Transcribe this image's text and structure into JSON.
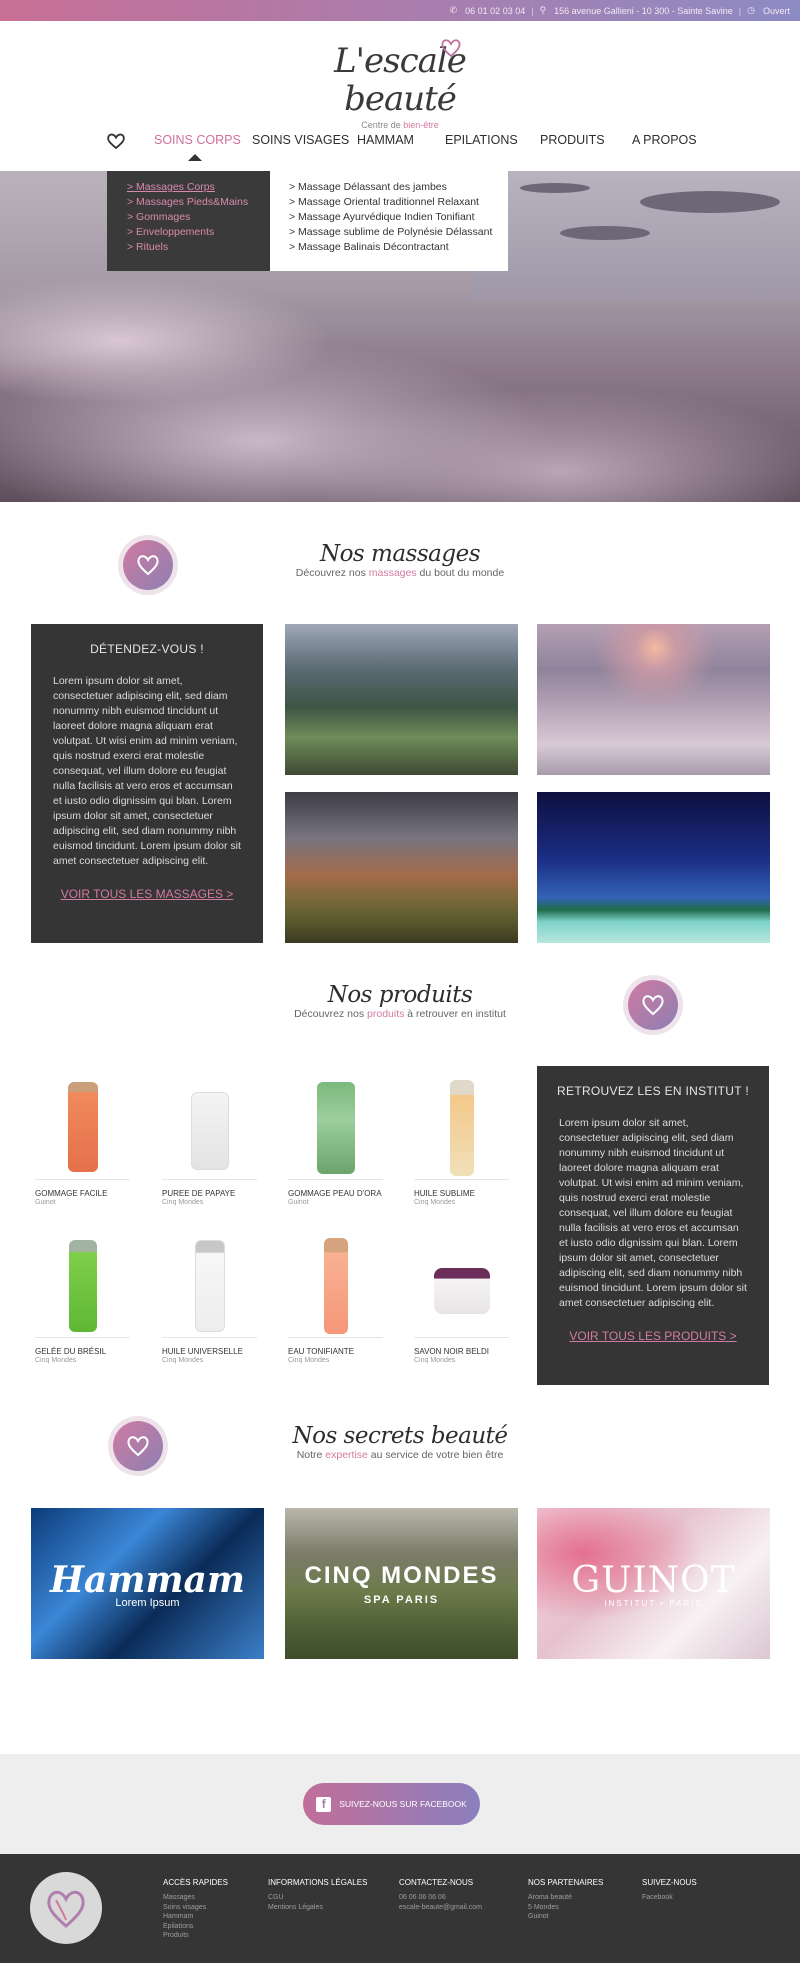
{
  "topbar": {
    "phone": "06 01 02 03 04",
    "address": "156 avenue Gallieni - 10 300 - Sainte Savine",
    "status": "Ouvert",
    "colors": {
      "gradient_start": "#c86f95",
      "gradient_end": "#8d8bc4"
    }
  },
  "logo": {
    "brand": "L'escale beauté",
    "tagline_prefix": "Centre de ",
    "tagline_highlight": "bien-être"
  },
  "nav": {
    "items": [
      {
        "label": "SOINS CORPS",
        "active": true
      },
      {
        "label": "SOINS VISAGES"
      },
      {
        "label": "HAMMAM"
      },
      {
        "label": "EPILATIONS"
      },
      {
        "label": "PRODUITS"
      },
      {
        "label": "A PROPOS"
      }
    ]
  },
  "dropdown": {
    "left": [
      "> Massages Corps",
      "> Massages Pieds&Mains",
      "> Gommages",
      "> Enveloppements",
      "> Rituels"
    ],
    "right": [
      "> Massage Délassant des jambes",
      "> Massage Oriental traditionnel Relaxant",
      "> Massage Ayurvédique Indien Tonifiant",
      "> Massage sublime de Polynésie Délassant",
      "> Massage Balinais Décontractant"
    ]
  },
  "massages": {
    "title": "Nos massages",
    "sub_prefix": "Découvrez nos ",
    "sub_highlight": "massages",
    "sub_suffix": " du bout du monde",
    "box": {
      "heading": "DÉTENDEZ-VOUS !",
      "text": "Lorem ipsum dolor sit amet, consectetuer adipiscing elit, sed diam nonummy nibh euismod tincidunt ut laoreet dolore magna aliquam erat volutpat. Ut wisi enim ad minim veniam, quis nostrud exerci erat molestie consequat, vel illum dolore eu feugiat nulla facilisis at vero eros et accumsan et iusto odio dignissim qui blan. Lorem ipsum dolor sit amet, consectetuer adipiscing elit, sed diam nonummy nibh euismod tincidunt. Lorem ipsum dolor sit amet consectetuer adipiscing elit.",
      "link": "VOIR TOUS LES MASSAGES >"
    }
  },
  "produits": {
    "title": "Nos produits",
    "sub_prefix": "Découvrez nos ",
    "sub_highlight": "produits",
    "sub_suffix": " à retrouver en institut",
    "items": [
      {
        "name": "GOMMAGE FACILE",
        "brand": "Guinot"
      },
      {
        "name": "PUREE DE PAPAYE",
        "brand": "Cinq Mondes"
      },
      {
        "name": "GOMMAGE PEAU D'ORA",
        "brand": "Guinot"
      },
      {
        "name": "HUILE SUBLIME",
        "brand": "Cinq Mondes"
      },
      {
        "name": "GELÉE DU BRÉSIL",
        "brand": "Cinq Mondes"
      },
      {
        "name": "HUILE UNIVERSELLE",
        "brand": "Cinq Mondes"
      },
      {
        "name": "EAU TONIFIANTE",
        "brand": "Cinq Mondes"
      },
      {
        "name": "SAVON NOIR BELDI",
        "brand": "Cinq Mondes"
      }
    ],
    "box": {
      "heading": "RETROUVEZ LES EN INSTITUT !",
      "text": "Lorem ipsum dolor sit amet, consectetuer adipiscing elit, sed diam nonummy nibh euismod tincidunt ut laoreet dolore magna aliquam erat volutpat. Ut wisi enim ad minim veniam, quis nostrud exerci erat molestie consequat, vel illum dolore eu feugiat nulla facilisis at vero eros et accumsan et iusto odio dignissim qui blan. Lorem ipsum dolor sit amet, consectetuer adipiscing elit, sed diam nonummy nibh euismod tincidunt. Lorem ipsum dolor sit amet consectetuer adipiscing elit.",
      "link": "VOIR TOUS LES PRODUITS >"
    }
  },
  "secrets": {
    "title": "Nos secrets beauté",
    "sub_prefix": "Notre ",
    "sub_highlight": "expertise",
    "sub_suffix": " au service de votre bien être",
    "tiles": [
      {
        "big": "Hammam",
        "small": "Lorem Ipsum"
      },
      {
        "big": "CINQ MONDES",
        "small": "SPA PARIS"
      },
      {
        "big": "GUINOT",
        "small": "INSTITUT • PARIS"
      }
    ]
  },
  "facebook": {
    "label": "SUIVEZ-NOUS SUR FACEBOOK",
    "icon": "facebook-icon"
  },
  "footer": {
    "columns": [
      {
        "heading": "ACCÈS RAPIDES",
        "links": [
          "Massages",
          "Soins visages",
          "Hammam",
          "Epilations",
          "Produits"
        ]
      },
      {
        "heading": "INFORMATIONS LÉGALES",
        "links": [
          "CGU",
          "Mentions Légales"
        ]
      },
      {
        "heading": "CONTACTEZ-NOUS",
        "links": [
          "06 06 06 06 06",
          "escale-beaute@gmail.com"
        ]
      },
      {
        "heading": "NOS PARTENAIRES",
        "links": [
          "Aroma beauté",
          "5 Mondes",
          "Guinot"
        ]
      },
      {
        "heading": "SUIVEZ-NOUS",
        "links": [
          "Facebook"
        ]
      }
    ]
  },
  "accent": "#d27ba0"
}
